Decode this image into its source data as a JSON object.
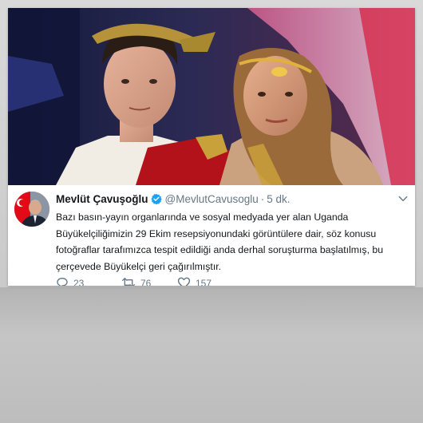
{
  "tweet": {
    "display_name": "Mevlüt Çavuşoğlu",
    "handle": "@MevlutCavusoglu",
    "separator": "·",
    "time": "5 dk.",
    "lines": [
      "Bazı basın-yayın organlarında ve sosyal medyada yer alan Uganda",
      "Büyükelçiliğimizin 29 Ekim resepsiyonundaki görüntülere dair, söz konusu",
      "fotoğraflar tarafımızca tespit edildiği anda derhal soruşturma başlatılmış, bu",
      "çerçevede Büyükelçi geri çağırılmıştır."
    ],
    "replies": "23",
    "retweets": "76",
    "likes": "157"
  },
  "icons": {
    "verified": "verified-badge-icon",
    "menu": "chevron-down-icon",
    "reply": "reply-icon",
    "retweet": "retweet-icon",
    "like": "heart-icon"
  },
  "colors": {
    "verified": "#1da1f2",
    "text": "#14171a",
    "secondary": "#657786",
    "avatar_flag": "#e30a17"
  }
}
